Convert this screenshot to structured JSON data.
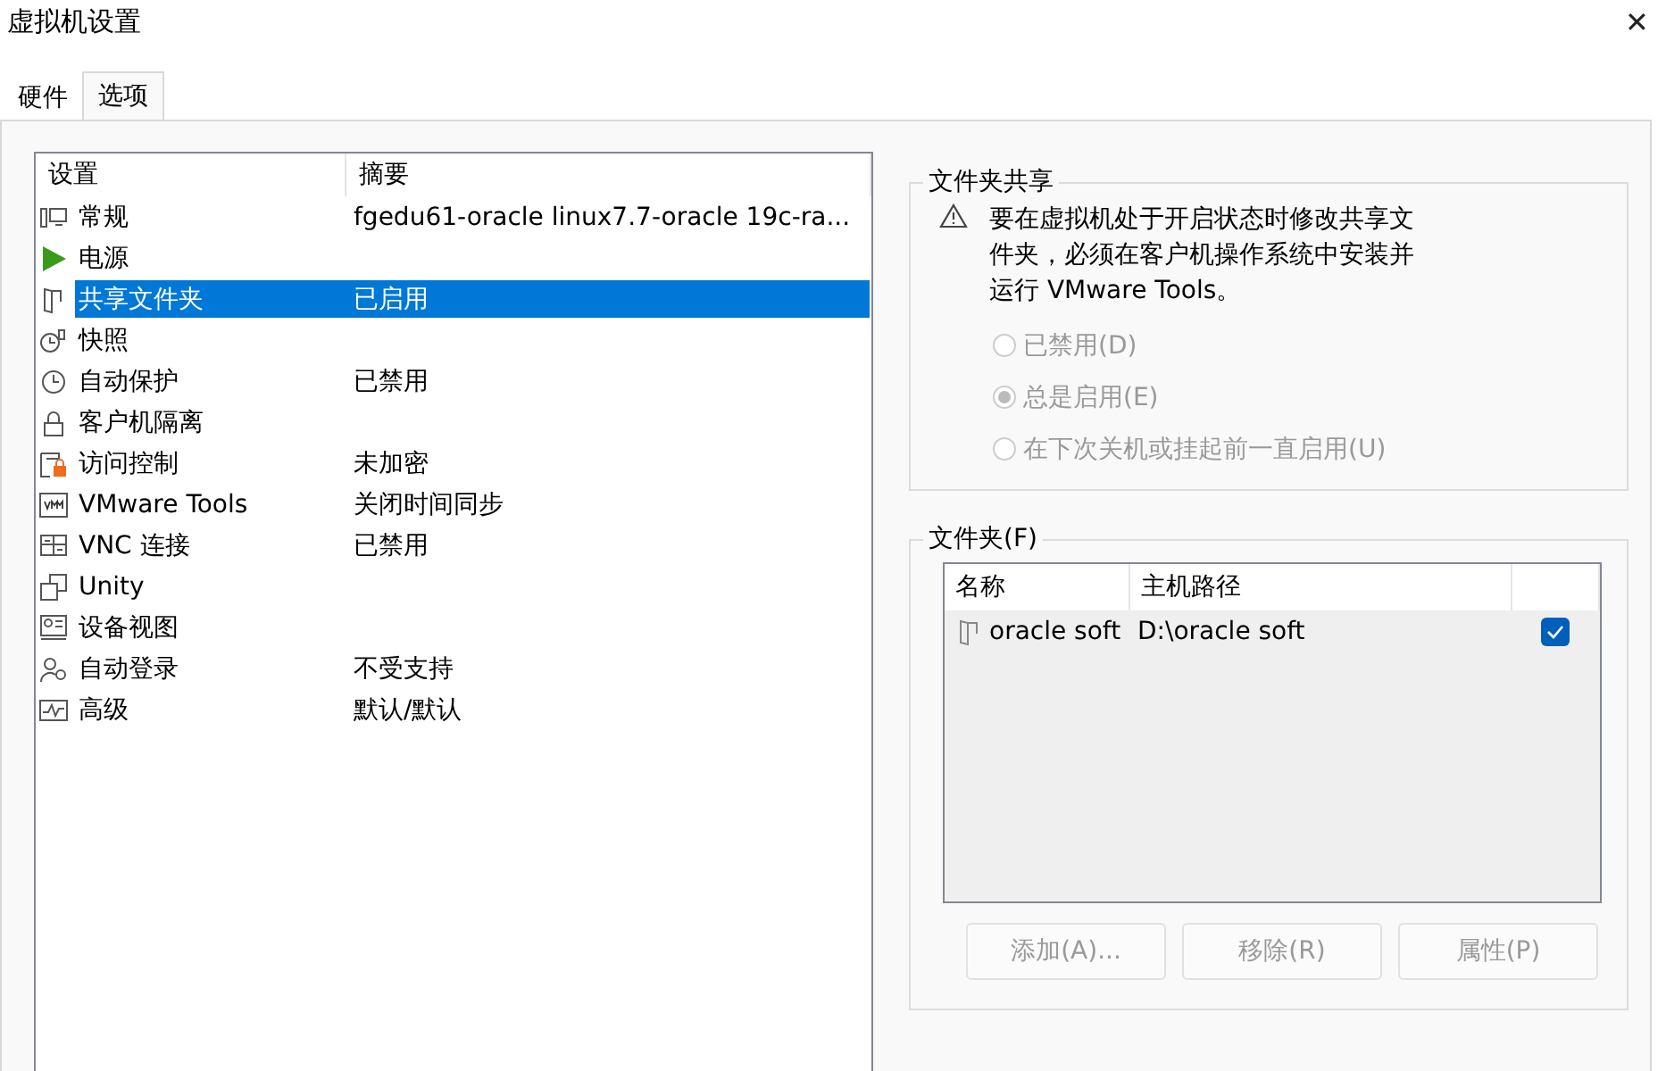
{
  "window": {
    "title": "虚拟机设置",
    "close": "✕"
  },
  "tabs": [
    {
      "label": "硬件",
      "selected": false
    },
    {
      "label": "选项",
      "selected": true
    }
  ],
  "settings": {
    "columns": [
      "设置",
      "摘要"
    ],
    "rows": [
      {
        "kind": "general",
        "name": "常规",
        "summary": "fgedu61-oracle linux7.7-oracle 19c-ra...",
        "selected": false
      },
      {
        "kind": "power",
        "name": "电源",
        "selected": false
      },
      {
        "kind": "shared",
        "name": "共享文件夹",
        "summary": "已启用",
        "selected": true
      },
      {
        "kind": "snapshot",
        "name": "快照",
        "selected": false
      },
      {
        "kind": "autoprotect",
        "name": "自动保护",
        "summary": "已禁用",
        "selected": false
      },
      {
        "kind": "isolation",
        "name": "客户机隔离",
        "selected": false
      },
      {
        "kind": "access",
        "name": "访问控制",
        "summary": "未加密",
        "selected": false
      },
      {
        "kind": "vmtools",
        "name": "VMware Tools",
        "summary": "关闭时间同步",
        "selected": false
      },
      {
        "kind": "vnc",
        "name": "VNC 连接",
        "summary": "已禁用",
        "selected": false
      },
      {
        "kind": "unity",
        "name": "Unity",
        "selected": false
      },
      {
        "kind": "device",
        "name": "设备视图",
        "selected": false
      },
      {
        "kind": "autologin",
        "name": "自动登录",
        "summary": "不受支持",
        "selected": false
      },
      {
        "kind": "advanced",
        "name": "高级",
        "summary": "默认/默认",
        "selected": false
      }
    ]
  },
  "sharing": {
    "title": "文件夹共享",
    "warning": "要在虚拟机处于开启状态时修改共享文件夹，必须在客户机操作系统中安装并运行 VMware Tools。",
    "options": [
      {
        "label": "已禁用(D)",
        "selected": false,
        "disabled": true
      },
      {
        "label": "总是启用(E)",
        "selected": true,
        "disabled": true
      },
      {
        "label": "在下次关机或挂起前一直启用(U)",
        "selected": false,
        "disabled": true
      }
    ]
  },
  "folders": {
    "title": "文件夹(F)",
    "columns": [
      "名称",
      "主机路径"
    ],
    "rows": [
      {
        "name": "oracle soft",
        "path": "D:\\oracle soft",
        "checked": true
      }
    ],
    "buttons": [
      {
        "label": "添加(A)...",
        "disabled": true
      },
      {
        "label": "移除(R)",
        "disabled": true
      },
      {
        "label": "属性(P)",
        "disabled": true
      }
    ]
  }
}
